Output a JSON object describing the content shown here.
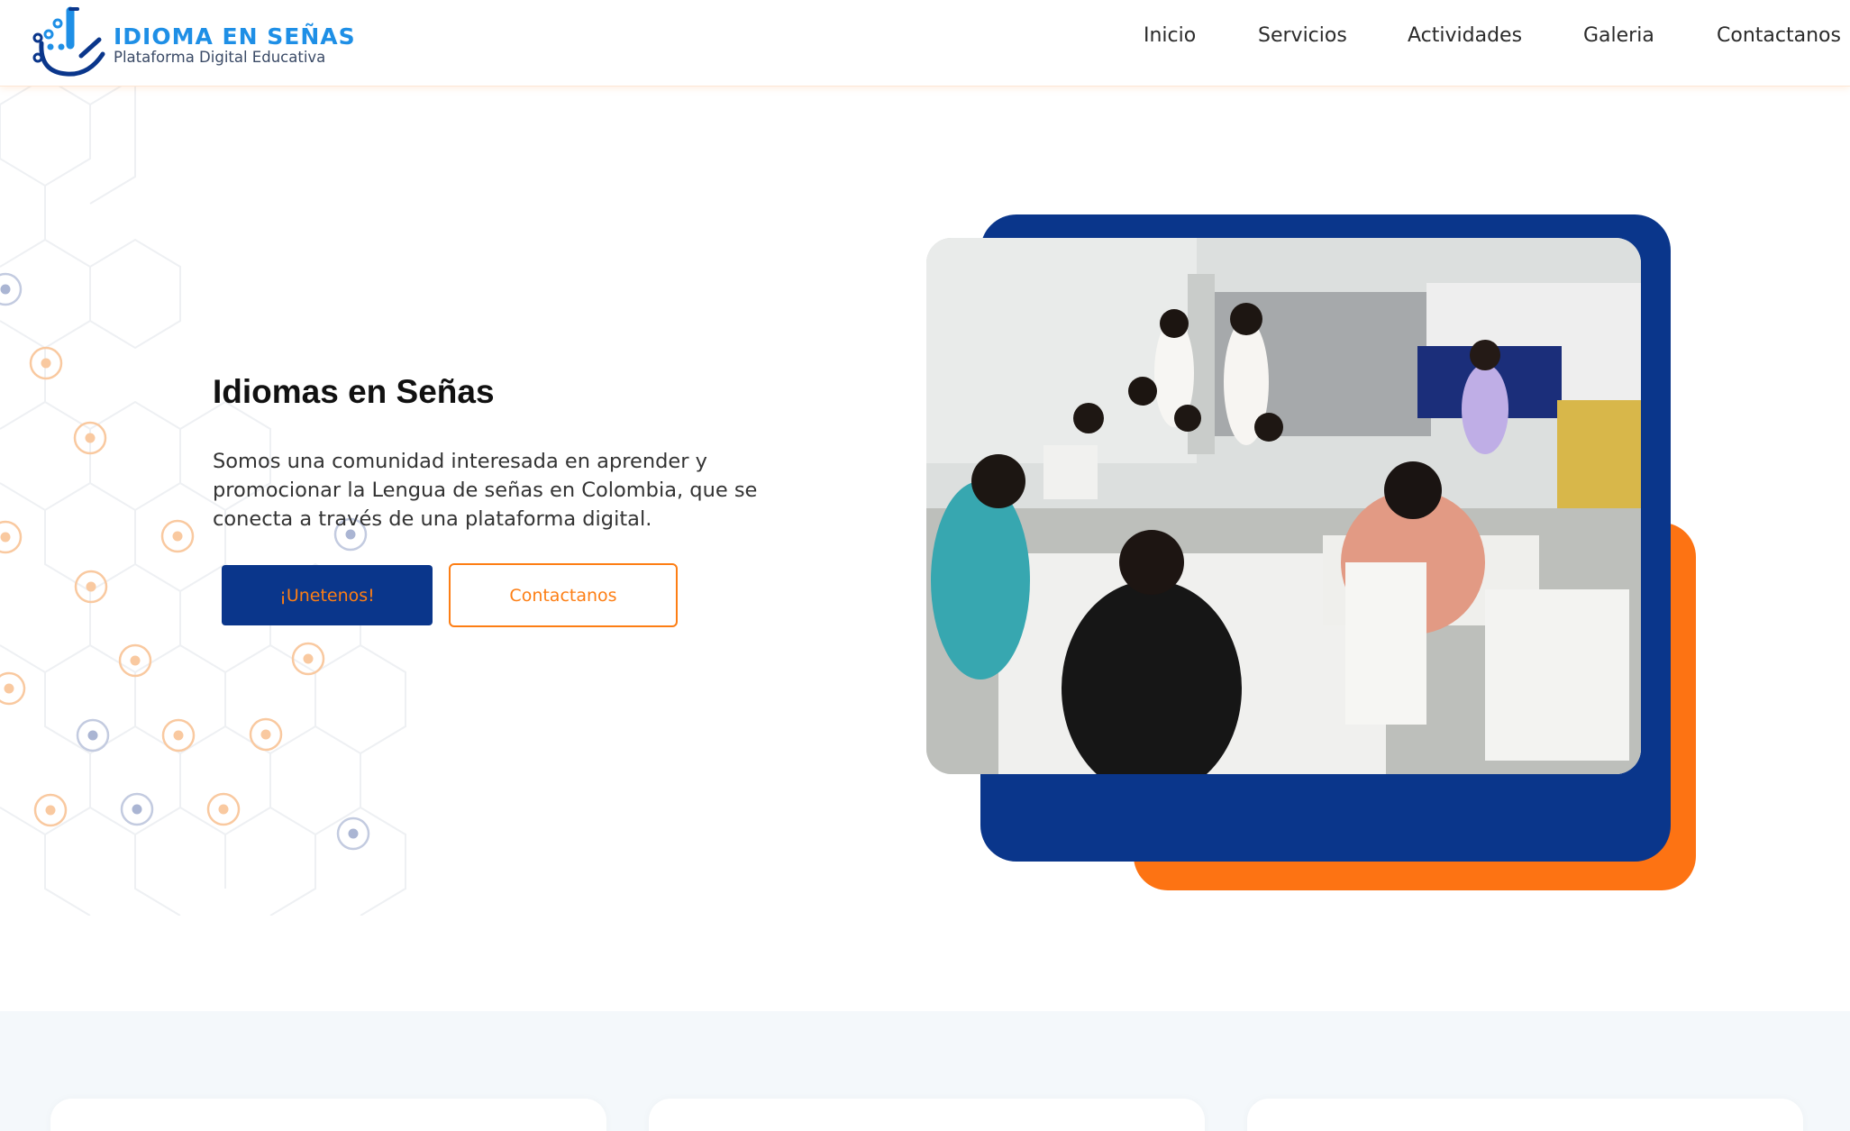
{
  "brand": {
    "title": "IDIOMA EN SEÑAS",
    "subtitle": "Plataforma Digital Educativa",
    "logo_icon": "sign-language-hand-icon"
  },
  "nav": {
    "items": [
      {
        "label": "Inicio"
      },
      {
        "label": "Servicios"
      },
      {
        "label": "Actividades"
      },
      {
        "label": "Galeria"
      },
      {
        "label": "Contactanos"
      }
    ]
  },
  "hero": {
    "title": "Idiomas en Señas",
    "description": "Somos una comunidad interesada en aprender y promocionar la Lengua de señas en Colombia, que se conecta a través de una plataforma digital.",
    "primary_button": "¡Unetenos!",
    "secondary_button": "Contactanos"
  },
  "colors": {
    "primary_blue": "#0a368b",
    "accent_orange": "#fd7313",
    "logo_blue": "#1e8fe6",
    "band_background": "#f4f8fb"
  }
}
